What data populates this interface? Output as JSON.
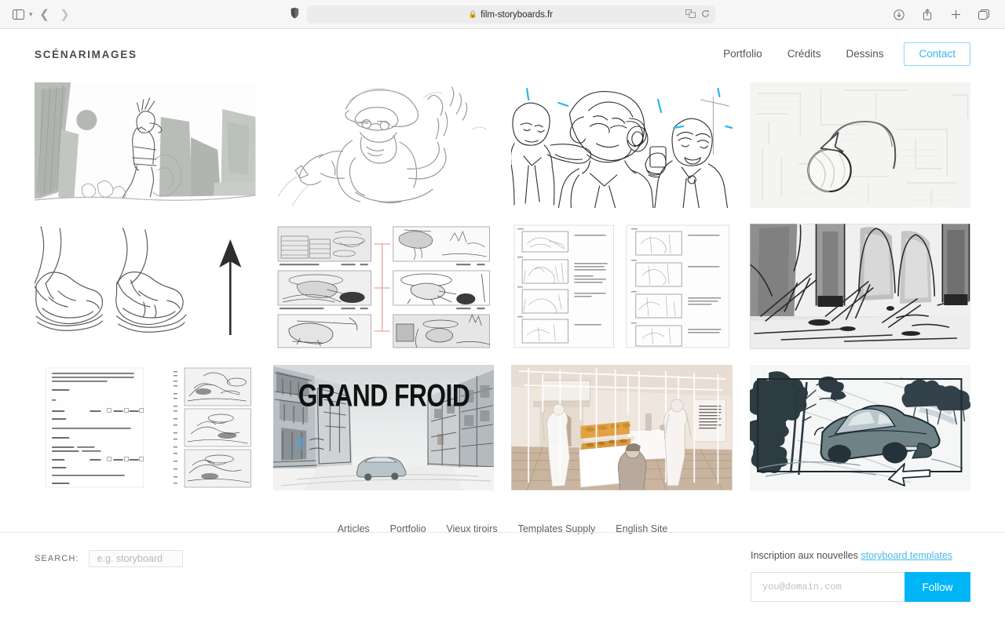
{
  "browser": {
    "url": "film-storyboards.fr",
    "lock_icon": "lock-icon",
    "sidebar_icon": "sidebar-toggle-icon",
    "back_icon": "back-chevron-icon",
    "forward_icon": "forward-chevron-icon",
    "shield_icon": "privacy-shield-icon",
    "translate_icon": "translate-icon",
    "reload_icon": "reload-icon",
    "downloads_icon": "downloads-icon",
    "share_icon": "share-icon",
    "newtab_icon": "new-tab-icon",
    "taboverview_icon": "tab-overview-icon"
  },
  "header": {
    "brand": "SCÉNARIMAGES",
    "nav": [
      {
        "label": "Portfolio",
        "name": "nav-portfolio"
      },
      {
        "label": "Crédits",
        "name": "nav-credits"
      },
      {
        "label": "Dessins",
        "name": "nav-dessins"
      }
    ],
    "cta": {
      "label": "Contact",
      "color": "#36b6f0",
      "border": "#8fd6f7"
    }
  },
  "gallery": {
    "items": [
      {
        "name": "thumb-desert-figure",
        "art": "desert",
        "alt": "Grayscale sketch of a figure walking between rock formations under a sun"
      },
      {
        "name": "thumb-pencil-man-hose",
        "art": "pencilman",
        "alt": "Pencil sketch of a bearded man in goggles holding a hose"
      },
      {
        "name": "thumb-lineart-crowd",
        "art": "crowd",
        "alt": "Line art of three men, one with headphones, blue accent strokes"
      },
      {
        "name": "thumb-arrow-sphere",
        "art": "sphere",
        "alt": "Faint pencil sketch with curved arrow pointing at a sphere"
      },
      {
        "name": "thumb-feet-sneakers",
        "art": "sneakers",
        "alt": "Two line drawings of legs in sneakers with an upward arrow"
      },
      {
        "name": "thumb-helicopter-board",
        "art": "heliboard",
        "alt": "Storyboard page of helicopter panels linked with red lines"
      },
      {
        "name": "thumb-two-page-board",
        "art": "twopage",
        "alt": "Two storyboard pages with framed panels and handwritten notes"
      },
      {
        "name": "thumb-cathedral-ruin",
        "art": "cathedral",
        "alt": "Ink wash of a ruined cathedral interior with fallen beams"
      },
      {
        "name": "thumb-script-and-panels",
        "art": "script",
        "alt": "Screenplay page beside a column of storyboard panels"
      },
      {
        "name": "thumb-grand-froid",
        "art": "grandfroid",
        "alt": "Snowy street painting with the title GRAND FROID",
        "overlay_title": "GRAND FROID"
      },
      {
        "name": "thumb-retail-interior",
        "art": "interior",
        "alt": "Sepia architectural rendering of a shop interior with people"
      },
      {
        "name": "thumb-car-chase",
        "art": "car",
        "alt": "Marker sketch of a muscle car speeding along a tree-lined road"
      }
    ]
  },
  "footer": {
    "links": [
      {
        "label": "Articles",
        "name": "footer-link-articles"
      },
      {
        "label": "Portfolio",
        "name": "footer-link-portfolio"
      },
      {
        "label": "Vieux tiroirs",
        "name": "footer-link-vieux-tiroirs"
      },
      {
        "label": "Templates Supply",
        "name": "footer-link-templates-supply"
      },
      {
        "label": "English Site",
        "name": "footer-link-english-site"
      }
    ]
  },
  "search": {
    "label": "SEARCH:",
    "value": "",
    "placeholder": "e.g. storyboard"
  },
  "subscribe": {
    "text_prefix": "Inscription aux nouvelles ",
    "link_label": "storyboard templates",
    "email_value": "",
    "email_placeholder": "you@domain.com",
    "button_label": "Follow",
    "button_color": "#00b5f5",
    "link_color": "#4ab9ef"
  }
}
